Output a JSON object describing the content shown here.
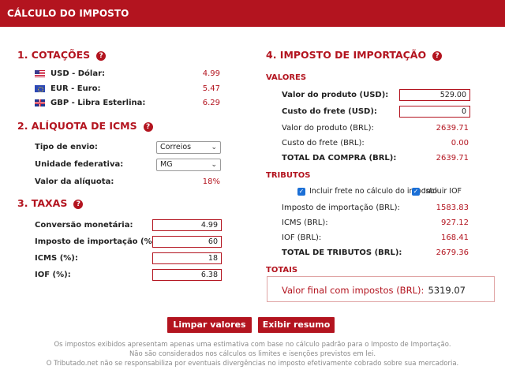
{
  "header": {
    "title": "CÁLCULO DO IMPOSTO"
  },
  "cotacoes": {
    "title": "1. COTAÇÕES",
    "rows": [
      {
        "label": "USD - Dólar:",
        "value": "4.99",
        "flag": "us-flag-icon"
      },
      {
        "label": "EUR - Euro:",
        "value": "5.47",
        "flag": "eu-flag-icon"
      },
      {
        "label": "GBP - Libra Esterlina:",
        "value": "6.29",
        "flag": "gb-flag-icon"
      }
    ]
  },
  "icms": {
    "title": "2. ALÍQUOTA DE ICMS",
    "tipo_label": "Tipo de envio:",
    "tipo_value": "Correios",
    "uf_label": "Unidade federativa:",
    "uf_value": "MG",
    "aliquota_label": "Valor da alíquota:",
    "aliquota_value": "18%"
  },
  "taxas": {
    "title": "3. TAXAS",
    "rows": [
      {
        "label": "Conversão monetária:",
        "value": "4.99"
      },
      {
        "label": "Imposto de importação (%):",
        "value": "60"
      },
      {
        "label": "ICMS (%):",
        "value": "18"
      },
      {
        "label": "IOF (%):",
        "value": "6.38"
      }
    ]
  },
  "importacao": {
    "title": "4. IMPOSTO DE IMPORTAÇÃO",
    "valores_title": "VALORES",
    "produto_usd_label": "Valor do produto (USD):",
    "produto_usd_value": "529.00",
    "frete_usd_label": "Custo do frete (USD):",
    "frete_usd_value": "0",
    "produto_brl_label": "Valor do produto (BRL):",
    "produto_brl_value": "2639.71",
    "frete_brl_label": "Custo do frete (BRL):",
    "frete_brl_value": "0.00",
    "total_compra_label": "TOTAL DA COMPRA (BRL):",
    "total_compra_value": "2639.71",
    "tributos_title": "TRIBUTOS",
    "chk_frete_label": "Incluir frete no cálculo do imposto",
    "chk_frete_checked": true,
    "chk_iof_label": "Incluir IOF",
    "chk_iof_checked": true,
    "imp_label": "Imposto de importação (BRL):",
    "imp_value": "1583.83",
    "icms_label": "ICMS (BRL):",
    "icms_value": "927.12",
    "iof_label": "IOF (BRL):",
    "iof_value": "168.41",
    "total_trib_label": "TOTAL DE TRIBUTOS (BRL):",
    "total_trib_value": "2679.36",
    "totais_title": "TOTAIS",
    "final_label": "Valor final com impostos (BRL):",
    "final_value": "5319.07"
  },
  "buttons": {
    "clear": "Limpar valores",
    "summary": "Exibir resumo"
  },
  "footer": {
    "line1": "Os impostos exibidos apresentam apenas uma estimativa com base no cálculo padrão para o Imposto de Importação.",
    "line2": "Não são considerados nos cálculos os limites e isenções previstos em lei.",
    "line3": "O Tributado.net não se responsabiliza por eventuais divergências no imposto efetivamente cobrado sobre sua mercadoria."
  },
  "colors": {
    "accent": "#b3141f",
    "checkbox": "#1b6fd6"
  }
}
